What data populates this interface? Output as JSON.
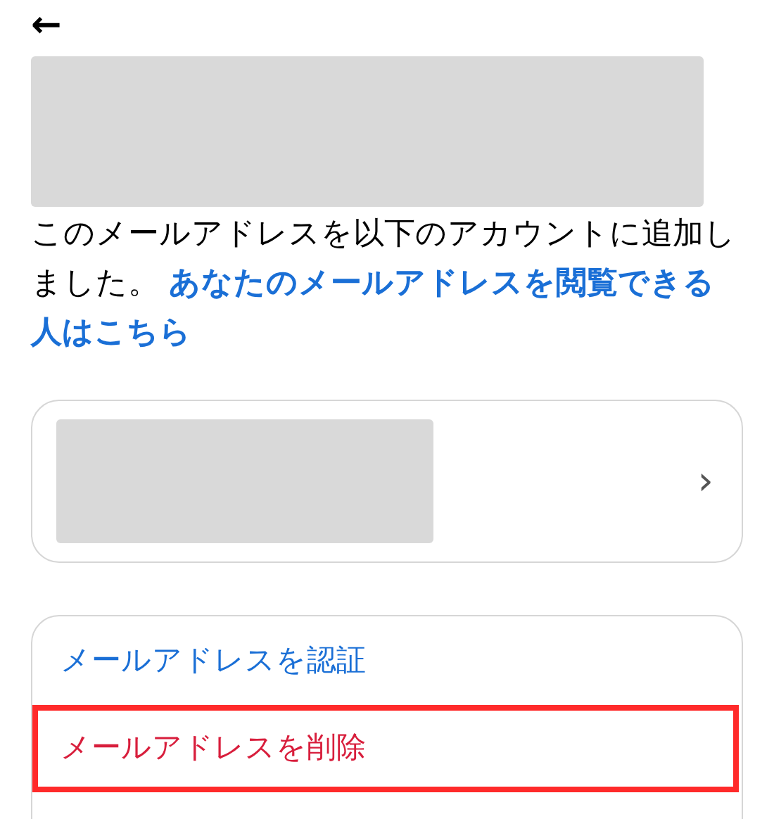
{
  "back_button": {
    "label": "←"
  },
  "description": {
    "text": "このメールアドレスを以下のアカウントに追加しました。",
    "link_lines": [
      "あなたのメールアドレスを閲覧できる",
      "人はこちら"
    ]
  },
  "account_card": {
    "chevron": "›"
  },
  "actions": [
    {
      "label": "メールアドレスを認証",
      "kind": "normal",
      "highlighted": false
    },
    {
      "label": "メールアドレスを削除",
      "kind": "danger",
      "highlighted": true
    }
  ]
}
